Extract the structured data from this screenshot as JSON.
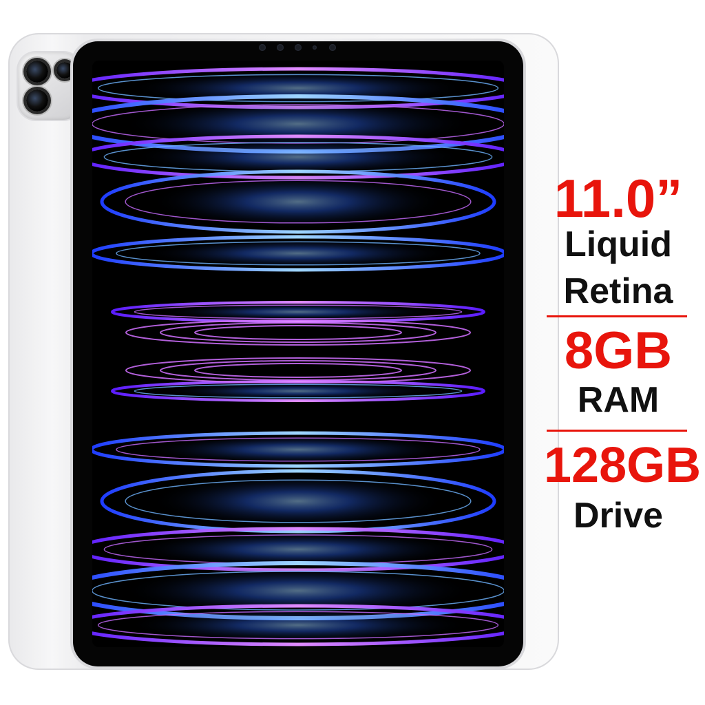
{
  "specs": {
    "display_size": "11.0”",
    "display_line1": "Liquid",
    "display_line2": "Retina",
    "ram_size": "8GB",
    "ram_label": "RAM",
    "storage_size": "128GB",
    "storage_label": "Drive"
  },
  "colors": {
    "accent_red": "#e8150c",
    "text_black": "#111111",
    "screen_blue": "#3a7bff",
    "screen_purple": "#b04dff"
  },
  "icons": [
    "camera-lens-icon",
    "front-camera-icon"
  ]
}
